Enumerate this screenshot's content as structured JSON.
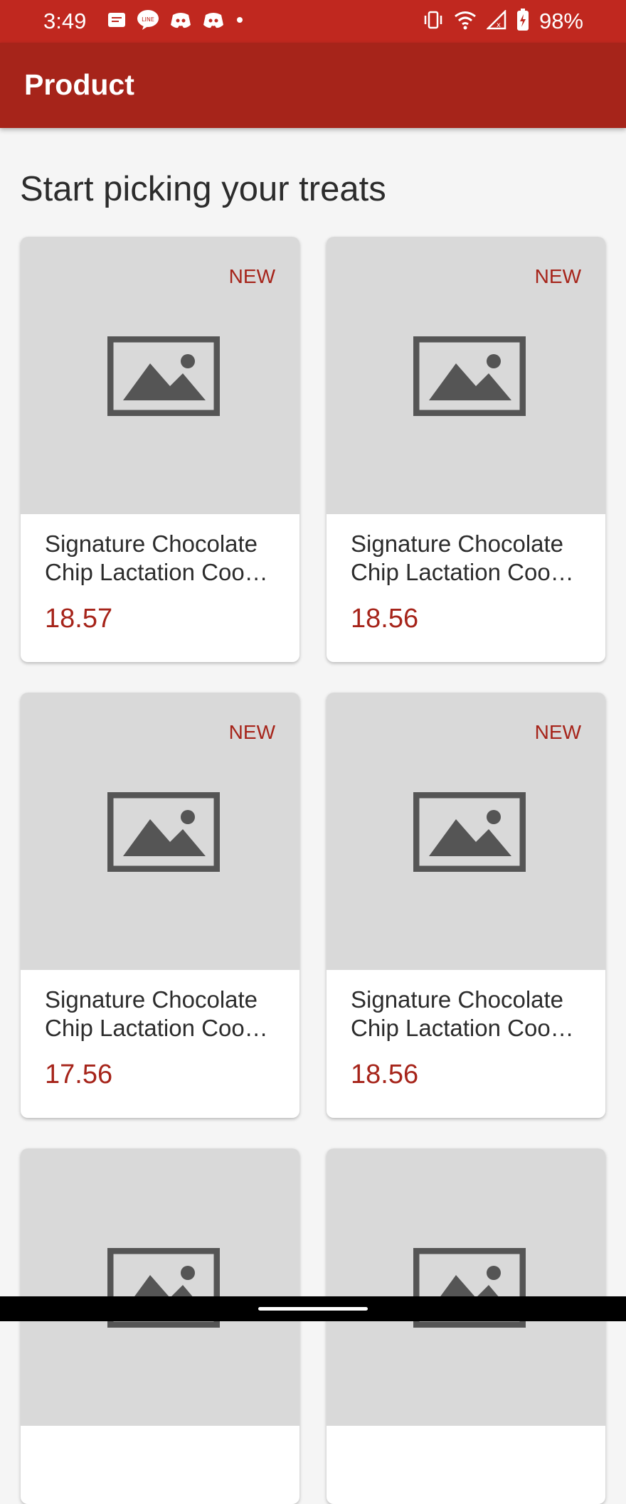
{
  "status_bar": {
    "time": "3:49",
    "battery": "98%",
    "left_icons": [
      "message-icon",
      "line-icon",
      "discord-icon",
      "discord-icon",
      "dot-icon"
    ],
    "right_icons": [
      "vibrate-icon",
      "wifi-icon",
      "signal-icon",
      "battery-charging-icon"
    ]
  },
  "app_bar": {
    "title": "Product"
  },
  "main": {
    "heading": "Start picking your treats",
    "products": [
      {
        "badge": "NEW",
        "title": "Signature Chocolate Chip Lactation Coo…",
        "price": "18.57"
      },
      {
        "badge": "NEW",
        "title": "Signature Chocolate Chip Lactation Coo…",
        "price": "18.56"
      },
      {
        "badge": "NEW",
        "title": "Signature Chocolate Chip Lactation Coo…",
        "price": "17.56"
      },
      {
        "badge": "NEW",
        "title": "Signature Chocolate Chip Lactation Coo…",
        "price": "18.56"
      }
    ]
  },
  "colors": {
    "status_bar": "#c0281f",
    "app_bar": "#a6241a",
    "accent": "#a6241a",
    "background": "#f5f5f5",
    "placeholder": "#d9d9d9"
  }
}
